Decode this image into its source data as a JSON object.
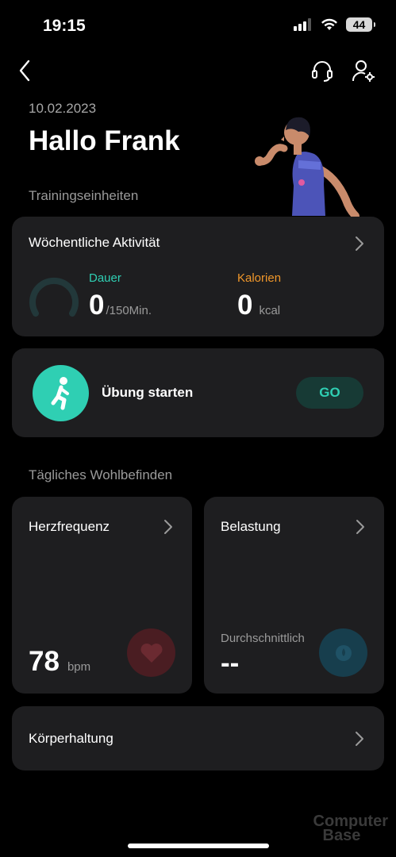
{
  "status_bar": {
    "time": "19:15",
    "battery": "44"
  },
  "header": {
    "date": "10.02.2023",
    "greeting": "Hallo Frank"
  },
  "training": {
    "section_label": "Trainingseinheiten",
    "weekly": {
      "title": "Wöchentliche Aktivität",
      "duration_label": "Dauer",
      "duration_value": "0",
      "duration_unit": "/150Min.",
      "calories_label": "Kalorien",
      "calories_value": "0",
      "calories_unit": "kcal"
    },
    "start": {
      "label": "Übung starten",
      "go_label": "GO"
    }
  },
  "wellbeing": {
    "section_label": "Tägliches Wohlbefinden",
    "heart": {
      "title": "Herzfrequenz",
      "value": "78",
      "unit": "bpm"
    },
    "stress": {
      "title": "Belastung",
      "sub_label": "Durchschnittlich",
      "value": "--"
    },
    "posture": {
      "title": "Körperhaltung"
    }
  },
  "watermark": {
    "line1": "Computer",
    "line2": "Base"
  },
  "colors": {
    "background": "#000000",
    "card": "#1e1e20",
    "accent_teal": "#2fcfb3",
    "accent_orange": "#f0972a",
    "heart_red": "#4a1d22",
    "stress_blue": "#173e4d"
  }
}
